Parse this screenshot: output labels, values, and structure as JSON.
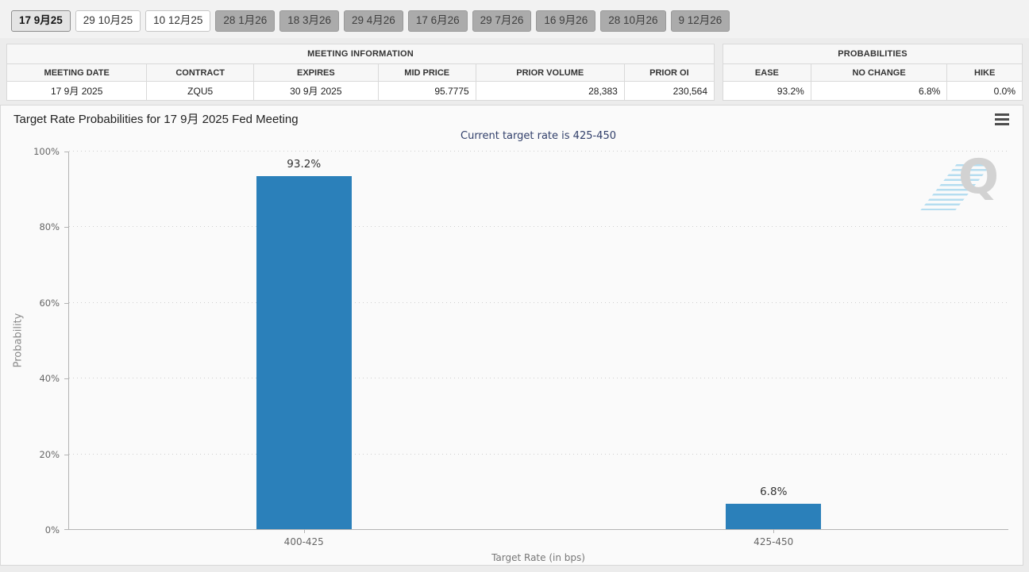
{
  "tab_bar": {
    "tabs": [
      {
        "label": "17 9月25",
        "state": "selected"
      },
      {
        "label": "29 10月25",
        "state": "normal"
      },
      {
        "label": "10 12月25",
        "state": "normal"
      },
      {
        "label": "28 1月26",
        "state": "inactive"
      },
      {
        "label": "18 3月26",
        "state": "inactive"
      },
      {
        "label": "29 4月26",
        "state": "inactive"
      },
      {
        "label": "17 6月26",
        "state": "inactive"
      },
      {
        "label": "29 7月26",
        "state": "inactive"
      },
      {
        "label": "16 9月26",
        "state": "inactive"
      },
      {
        "label": "28 10月26",
        "state": "inactive"
      },
      {
        "label": "9 12月26",
        "state": "inactive"
      }
    ]
  },
  "meeting_info_table": {
    "title": "MEETING INFORMATION",
    "columns": [
      "MEETING DATE",
      "CONTRACT",
      "EXPIRES",
      "MID PRICE",
      "PRIOR VOLUME",
      "PRIOR OI"
    ],
    "col_widths": [
      19.8,
      15.1,
      17.6,
      13.8,
      21.0,
      12.7
    ],
    "row": [
      "17 9月 2025",
      "ZQU5",
      "30 9月 2025",
      "95.7775",
      "28,383",
      "230,564"
    ],
    "align": [
      "center",
      "center",
      "center",
      "right",
      "right",
      "right"
    ]
  },
  "probabilities_table": {
    "title": "PROBABILITIES",
    "columns": [
      "EASE",
      "NO CHANGE",
      "HIKE"
    ],
    "col_widths": [
      29.4,
      45.5,
      25.1
    ],
    "row": [
      "93.2%",
      "6.8%",
      "0.0%"
    ],
    "align": [
      "right",
      "right",
      "right"
    ]
  },
  "chart": {
    "title": "Target Rate Probabilities for 17 9月 2025 Fed Meeting",
    "subtitle": "Current target rate is 425-450",
    "watermark": "Q"
  },
  "chart_data": {
    "type": "bar",
    "categories": [
      "400-425",
      "425-450"
    ],
    "values": [
      93.2,
      6.8
    ],
    "value_labels": [
      "93.2%",
      "6.8%"
    ],
    "title": "Target Rate Probabilities for 17 9月 2025 Fed Meeting",
    "subtitle": "Current target rate is 425-450",
    "xlabel": "Target Rate (in bps)",
    "ylabel": "Probability",
    "ylim": [
      0,
      100
    ],
    "yticks": [
      0,
      20,
      40,
      60,
      80,
      100
    ],
    "ytick_labels": [
      "0%",
      "20%",
      "40%",
      "60%",
      "80%",
      "100%"
    ],
    "grid": "dotted-horizontal",
    "legend": "none",
    "bar_color": "#2b80ba"
  },
  "colors": {
    "bar": "#2b80ba",
    "subtitle_text": "#32406b",
    "page_background": "#ececec",
    "panel_background": "#fafafa",
    "inactive_tab": "#ababab"
  }
}
